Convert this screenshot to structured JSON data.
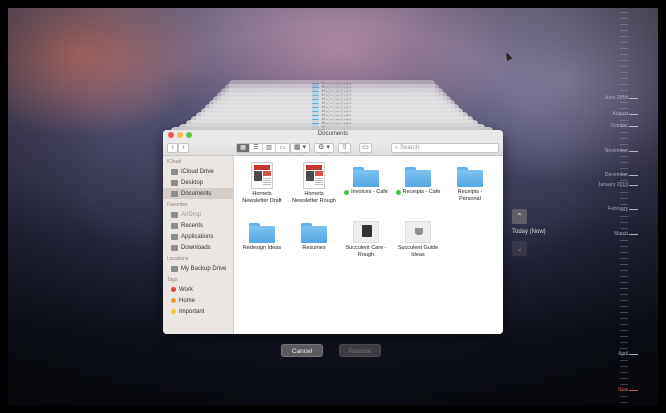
{
  "finder": {
    "title": "Documents",
    "search_placeholder": "Search",
    "toolbar": {
      "back": "‹",
      "forward": "›",
      "arrange": "▦ ▾",
      "action": "⚙ ▾"
    }
  },
  "ghost_windows": {
    "title": "Documents"
  },
  "sidebar": {
    "sections": [
      {
        "header": "iCloud",
        "items": [
          {
            "label": "iCloud Drive",
            "icon": "cloud-icon"
          },
          {
            "label": "Desktop",
            "icon": "desktop-icon"
          },
          {
            "label": "Documents",
            "icon": "documents-icon",
            "selected": true
          }
        ]
      },
      {
        "header": "Favorites",
        "items": [
          {
            "label": "AirDrop",
            "icon": "airdrop-icon",
            "dim": true
          },
          {
            "label": "Recents",
            "icon": "clock-icon"
          },
          {
            "label": "Applications",
            "icon": "applications-icon"
          },
          {
            "label": "Downloads",
            "icon": "downloads-icon"
          }
        ]
      },
      {
        "header": "Locations",
        "items": [
          {
            "label": "My Backup Drive",
            "icon": "drive-icon"
          }
        ]
      },
      {
        "header": "Tags",
        "items": [
          {
            "label": "Work",
            "color": "#e2463d"
          },
          {
            "label": "Home",
            "color": "#f59a2e"
          },
          {
            "label": "Important",
            "color": "#f4c630"
          }
        ]
      }
    ]
  },
  "files": [
    {
      "label": "Hornets\nNewsletter Draft",
      "kind": "doc"
    },
    {
      "label": "Hornets\nNewsletter Rough",
      "kind": "doc"
    },
    {
      "label": "Invoices - Cafe",
      "kind": "folder",
      "tag_color": "#4ec24a"
    },
    {
      "label": "Receipts - Cafe",
      "kind": "folder",
      "tag_color": "#4ec24a"
    },
    {
      "label": "Receipts -\nPersonal",
      "kind": "folder"
    },
    {
      "label": "Redesign Ideas",
      "kind": "folder"
    },
    {
      "label": "Resumes",
      "kind": "folder"
    },
    {
      "label": "Succulent Care -\nRough",
      "kind": "image"
    },
    {
      "label": "Succulent Guide\nIdeas",
      "kind": "image2"
    }
  ],
  "buttons": {
    "cancel": "Cancel",
    "restore": "Restore"
  },
  "nav": {
    "up": "⌃",
    "down": "⌄",
    "today": "Today (Now)"
  },
  "timeline": {
    "labels": [
      {
        "text": "June 2018",
        "pos": 0.226
      },
      {
        "text": "August",
        "pos": 0.266
      },
      {
        "text": "October",
        "pos": 0.298
      },
      {
        "text": "November",
        "pos": 0.359
      },
      {
        "text": "December",
        "pos": 0.42
      },
      {
        "text": "January 2019",
        "pos": 0.446
      },
      {
        "text": "February",
        "pos": 0.506
      },
      {
        "text": "March",
        "pos": 0.569
      },
      {
        "text": "April",
        "pos": 0.871
      },
      {
        "text": "Now",
        "pos": 0.963,
        "now": true
      }
    ]
  }
}
